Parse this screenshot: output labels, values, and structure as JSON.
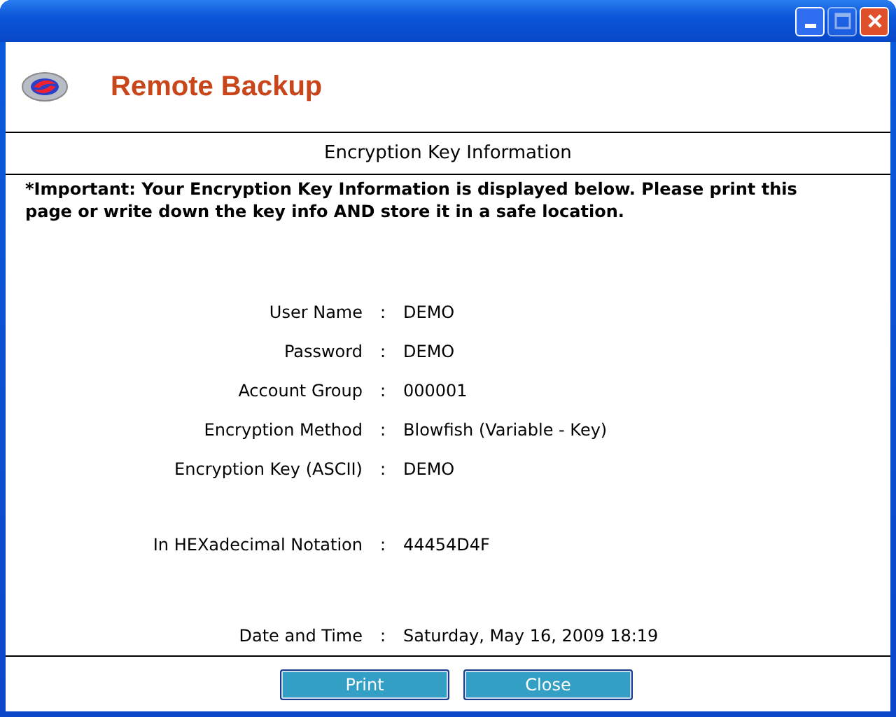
{
  "window": {
    "controls": [
      {
        "kind": "minimize"
      },
      {
        "kind": "maximize",
        "disabled": true
      },
      {
        "kind": "close"
      }
    ]
  },
  "header": {
    "title": "Remote Backup"
  },
  "section": {
    "title": "Encryption Key Information"
  },
  "notice": "*Important:  Your Encryption Key Information is displayed below.  Please print this page or write down the key info AND store it in a safe location.",
  "groups": [
    {
      "rows": [
        {
          "label": "User Name",
          "sep": ":",
          "value": "DEMO"
        },
        {
          "label": "Password",
          "sep": ":",
          "value": "DEMO"
        },
        {
          "label": "Account Group",
          "sep": ":",
          "value": "000001"
        },
        {
          "label": "Encryption Method",
          "sep": ":",
          "value": "Blowfish (Variable - Key)"
        },
        {
          "label": "Encryption Key (ASCII)",
          "sep": ":",
          "value": "DEMO"
        }
      ]
    },
    {
      "rows": [
        {
          "label": "In HEXadecimal Notation",
          "sep": ":",
          "value": "44454D4F"
        }
      ]
    },
    {
      "rows": [
        {
          "label": "Date and Time",
          "sep": ":",
          "value": "Saturday, May 16, 2009 18:19"
        }
      ]
    }
  ],
  "buttons": [
    "Print",
    "Close"
  ]
}
